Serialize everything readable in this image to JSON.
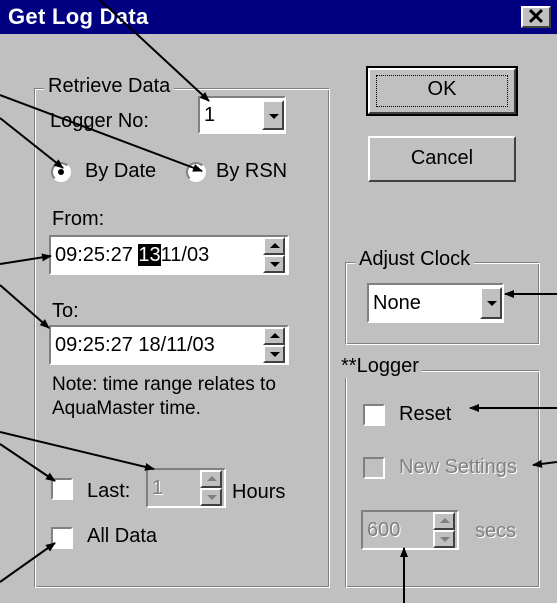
{
  "window": {
    "title": "Get Log Data",
    "close_glyph": "✕"
  },
  "buttons": {
    "ok": "OK",
    "cancel": "Cancel"
  },
  "retrieve": {
    "caption": "Retrieve Data",
    "logger_no_label": "Logger No:",
    "logger_no_value": "1",
    "by_date_label": "By Date",
    "by_rsn_label": "By RSN",
    "by_date_selected": true,
    "from_label": "From:",
    "from_time": "09:25:27",
    "from_day": "13",
    "from_rest": "11/03",
    "to_label": "To:",
    "to_value": "09:25:27 18/11/03",
    "note": "Note: time range relates to AquaMaster time.",
    "last_label": "Last:",
    "last_value": "1",
    "hours_label": "Hours",
    "all_data_label": "All Data"
  },
  "adjust_clock": {
    "caption": "Adjust Clock",
    "value": "None"
  },
  "logger": {
    "prefix": "**",
    "caption": "Logger",
    "reset_label": "Reset",
    "new_settings_label": "New Settings",
    "secs_value": "600",
    "secs_label": "secs"
  },
  "colors": {
    "titlebar": "#000080",
    "face": "#c0c0c0"
  }
}
